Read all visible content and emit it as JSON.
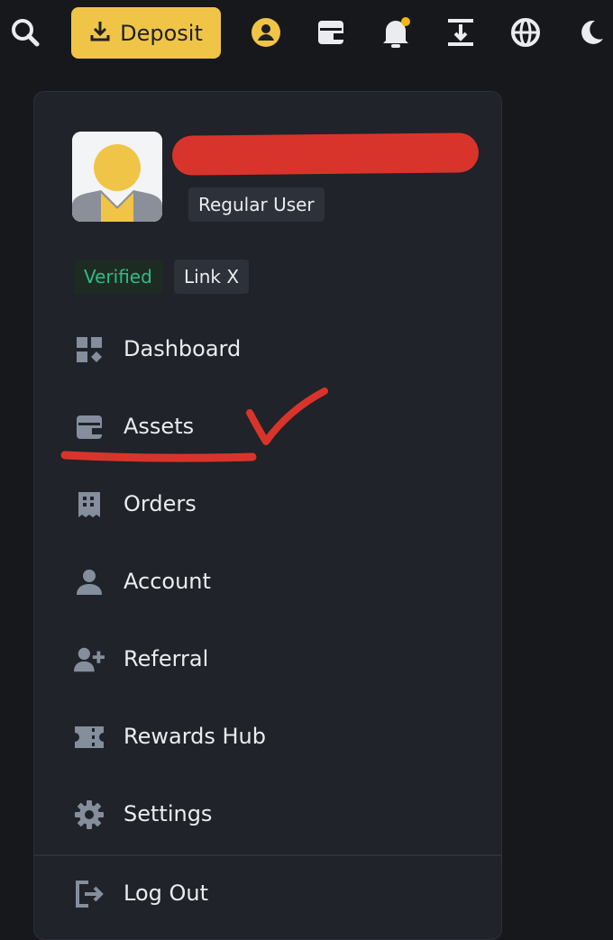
{
  "header": {
    "deposit_label": "Deposit",
    "icons": [
      "search-icon",
      "download-icon",
      "user-circle-icon",
      "wallet-icon",
      "bell-icon",
      "transfer-icon",
      "globe-icon",
      "moon-icon"
    ],
    "notification_dot_color": "#f0b90b"
  },
  "profile": {
    "user_type": "Regular User",
    "verified_label": "Verified",
    "link_label": "Link X"
  },
  "menu": {
    "items": [
      {
        "label": "Dashboard",
        "icon": "dashboard-icon"
      },
      {
        "label": "Assets",
        "icon": "wallet-icon"
      },
      {
        "label": "Orders",
        "icon": "receipt-icon"
      },
      {
        "label": "Account",
        "icon": "person-icon"
      },
      {
        "label": "Referral",
        "icon": "person-add-icon"
      },
      {
        "label": "Rewards Hub",
        "icon": "ticket-icon"
      },
      {
        "label": "Settings",
        "icon": "gear-icon"
      },
      {
        "label": "Log Out",
        "icon": "logout-icon"
      }
    ]
  },
  "colors": {
    "accent": "#f0c547",
    "verified": "#2ebd85",
    "annotation": "#d9342b"
  }
}
